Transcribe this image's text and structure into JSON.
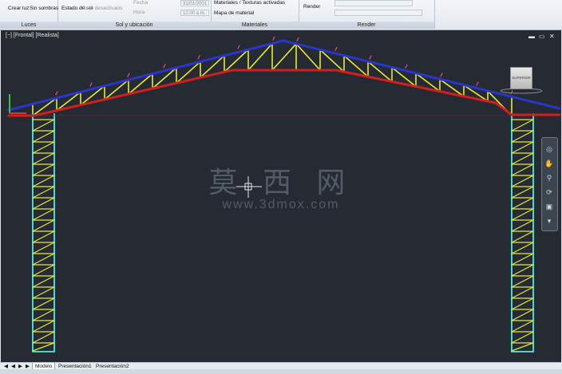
{
  "ribbon": {
    "lights": {
      "create_light": "Crear luz",
      "no_shadows": "Sin sombras",
      "footer": "Luces"
    },
    "sun": {
      "sun_status": "Estado de sol",
      "sky_off": "Cielo desactivado",
      "date_label": "Fecha",
      "time_label": "Hora",
      "date_value": "31/01/2001",
      "time_value": "12:00 a.m.",
      "footer": "Sol y ubicación"
    },
    "materials": {
      "textures_toggle": "Materiales / Texturas activadas",
      "material_map": "Mapa de material",
      "footer": "Materiales"
    },
    "render": {
      "render_button": "Render",
      "footer": "Render"
    }
  },
  "viewport": {
    "label": "[−] [Frontal] [Realista]",
    "cube_face": "SUPERIOR",
    "controls": [
      "▬",
      "▭",
      "✕"
    ]
  },
  "watermark": {
    "chinese": "莫 西 网",
    "site": "www.3dmox.com"
  },
  "tabs": {
    "nav": [
      "◀",
      "◀",
      "▶",
      "▶"
    ],
    "items": [
      "Modelo",
      "Presentación1",
      "Presentación2"
    ]
  },
  "colors": {
    "viewport_bg": "#252a33",
    "top_chord": "#2b35c9",
    "bottom_chord": "#d11f1f",
    "webbing": "#e7ea3a",
    "columns": "#49d6cf",
    "brackets": "#e8459a"
  }
}
